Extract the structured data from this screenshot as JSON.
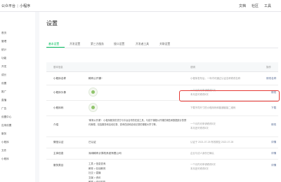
{
  "topbar": {
    "brand": "公众平台",
    "sep": "|",
    "product": "小程序",
    "nav": [
      "文档",
      "社区",
      "工具"
    ]
  },
  "sidebar": {
    "items": [
      "首页",
      "管理",
      "统计",
      "功能",
      "开发",
      "成长",
      "设置",
      "推广",
      "直播",
      "广告",
      "设置中心",
      "应用设置",
      "服务",
      "小程序",
      "文件",
      "小程序"
    ]
  },
  "page": {
    "title": "设置"
  },
  "tabs": [
    "基本设置",
    "开发设置",
    "第三方服务",
    "接口设置",
    "开发者工具",
    "关联设置"
  ],
  "table": {
    "headers": [
      "基本信息",
      "说明",
      "操作"
    ],
    "rows": [
      {
        "label": "小程序名称",
        "value": "稀有公开课~",
        "desc": "小程序发布后，一年内可通过认证名称修改名称",
        "action": "修改名称"
      },
      {
        "label": "小程序头像",
        "value": "",
        "desc": "一个月内可申请修改5次\n本月还可修改5次",
        "action": "修改"
      },
      {
        "label": "小程序码",
        "value": "",
        "desc": "下载不同尺寸的小程序码和普通链接二维码",
        "action": "下载"
      },
      {
        "label": "介绍",
        "value": "“稀有公开课”：小程序服务供货方与平台合作的在线工具，与线下课程公开课的销售和数据统计的预约管理，包括服务和活动记录、查询在线和活动记录的课程大学习等。",
        "desc": "一个月内可申请修改5次\n本月还可修改5次",
        "action": "修改"
      },
      {
        "label": "微信认证",
        "value": "已认证",
        "desc": "认证于 2021-07-28 有效期至 2022-07-28",
        "action": "详情"
      },
      {
        "label": "主体信息",
        "value": "深圳稀有计算机系统有限公司",
        "desc": "企业与法人身份已确认",
        "action": "详情"
      },
      {
        "label": "服务类目",
        "value": "工具 > 信息查询\n教育 > 在线教育\n社交 > 直播\n文娱 > 资讯\n教育 > 培训机构",
        "desc": "一个月内可申请修改5次\n本月还可修改5次",
        "action": "详情"
      }
    ]
  }
}
